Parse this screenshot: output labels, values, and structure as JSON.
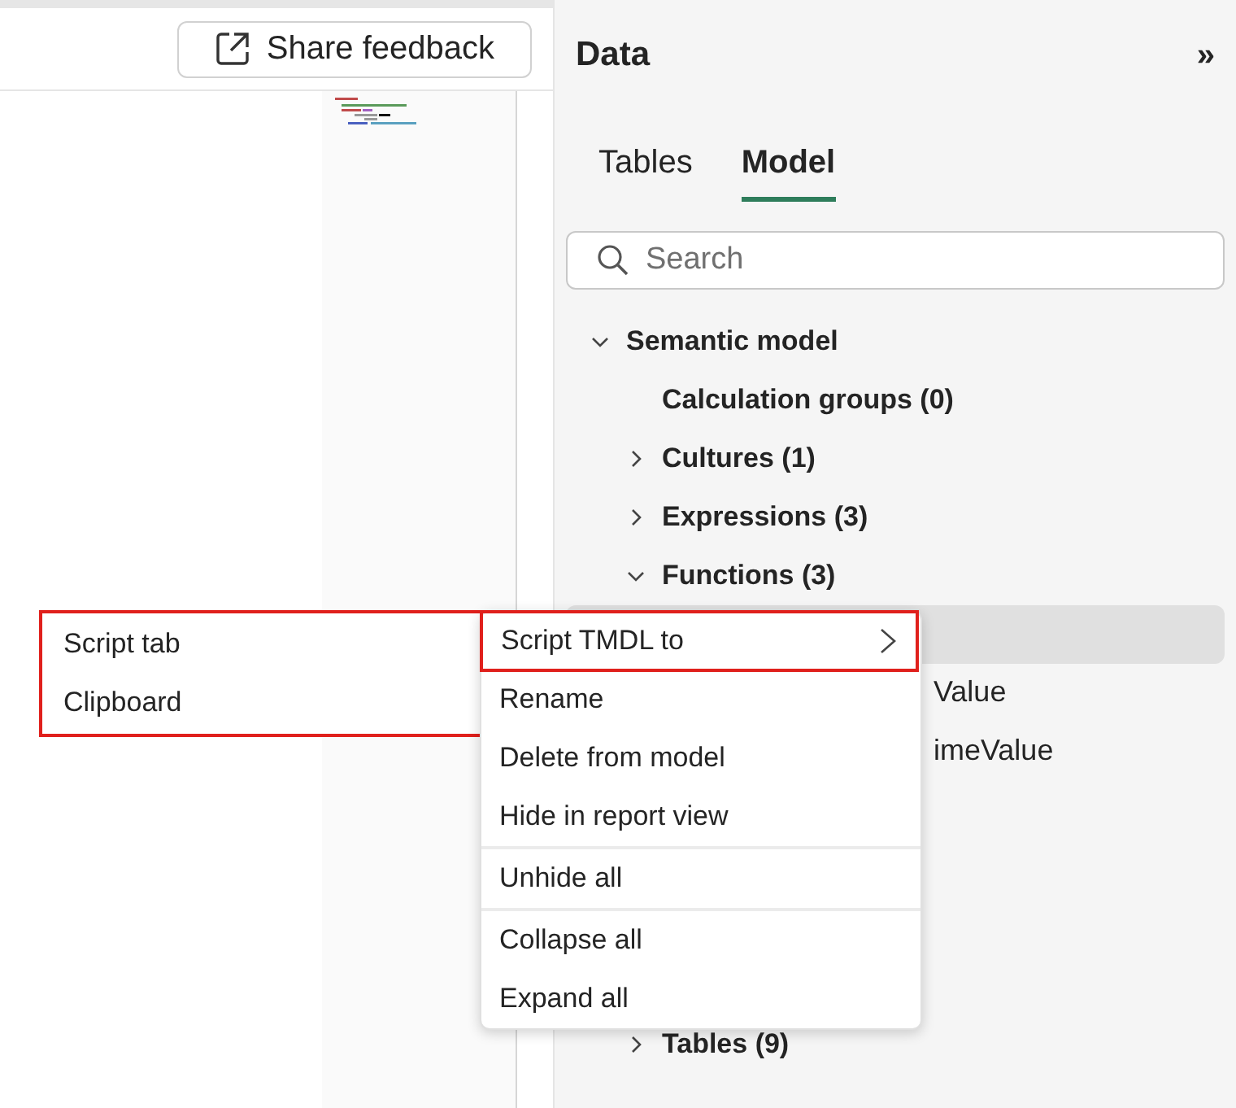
{
  "toolbar": {
    "feedback_button": "Share feedback"
  },
  "panel": {
    "title": "Data",
    "collapse": "»",
    "tabs": [
      {
        "label": "Tables",
        "selected": false
      },
      {
        "label": "Model",
        "selected": true
      }
    ],
    "search": {
      "placeholder": "Search"
    },
    "tree": [
      {
        "label": "Semantic model",
        "expanded": true,
        "children": [
          {
            "label": "Calculation groups (0)"
          },
          {
            "label": "Cultures (1)",
            "expanded": false
          },
          {
            "label": "Expressions (3)",
            "expanded": false
          },
          {
            "label": "Functions (3)",
            "expanded": true,
            "children": [
              {
                "selected": true
              },
              {
                "label": "Value",
                "selected": false
              },
              {
                "label": "imeValue",
                "selected": false
              }
            ]
          },
          {
            "label": "Tables (9)",
            "expanded": false
          }
        ]
      }
    ]
  },
  "context_menu": {
    "items": [
      {
        "label": "Script TMDL to",
        "submenu": true,
        "highlighted": true,
        "divider_after": false
      },
      {
        "label": "Rename",
        "submenu": false,
        "highlighted": false,
        "divider_after": false
      },
      {
        "label": "Delete from model",
        "submenu": false,
        "highlighted": false,
        "divider_after": false
      },
      {
        "label": "Hide in report view",
        "submenu": false,
        "highlighted": false,
        "divider_after": true
      },
      {
        "label": "Unhide all",
        "submenu": false,
        "highlighted": false,
        "divider_after": true
      },
      {
        "label": "Collapse all",
        "submenu": false,
        "highlighted": false,
        "divider_after": false
      },
      {
        "label": "Expand all",
        "submenu": false,
        "highlighted": false,
        "divider_after": false
      }
    ]
  },
  "submenu": {
    "highlighted": true,
    "items": [
      "Script tab",
      "Clipboard"
    ]
  }
}
